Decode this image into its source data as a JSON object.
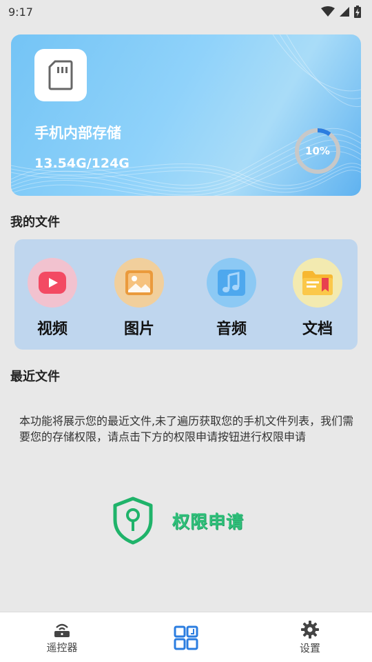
{
  "status_bar": {
    "time": "9:17",
    "icons": [
      "wifi-icon",
      "cell-signal-icon",
      "battery-icon"
    ]
  },
  "storage": {
    "title": "手机内部存储",
    "size": "13.54G/124G",
    "percent_label": "10%",
    "used_fraction": 0.1,
    "icon": "sd-card-icon"
  },
  "my_files": {
    "title": "我的文件",
    "categories": [
      {
        "label": "视频",
        "icon": "video-play-icon",
        "color": "#f2c2cf"
      },
      {
        "label": "图片",
        "icon": "image-icon",
        "color": "#f1cf9c"
      },
      {
        "label": "音频",
        "icon": "music-note-icon",
        "color": "#8cc9f4"
      },
      {
        "label": "文档",
        "icon": "folder-document-icon",
        "color": "#f3eab0"
      }
    ]
  },
  "recent_files": {
    "title": "最近文件",
    "description": "本功能将展示您的最近文件,未了遍历获取您的手机文件列表，我们需要您的存储权限，请点击下方的权限申请按钮进行权限申请",
    "permission_button": "权限申请"
  },
  "bottom_nav": {
    "items": [
      {
        "label": "遥控器",
        "icon": "remote-router-icon"
      },
      {
        "label": "",
        "icon": "grid-apps-icon"
      },
      {
        "label": "设置",
        "icon": "gear-icon"
      }
    ]
  },
  "colors": {
    "accent": "#2b7de0",
    "permission_green": "#2fbf7a",
    "panel": "#bfd6ee"
  }
}
